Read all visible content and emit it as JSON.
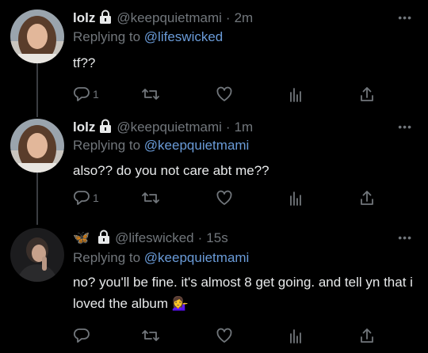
{
  "tweets": [
    {
      "name": "lolz",
      "handle": "@keepquietmami",
      "dot": "·",
      "time": "2m",
      "reply_prefix": "Replying to",
      "reply_to": "@lifeswicked",
      "text": "tf??",
      "reply_count": "1",
      "more": "•••"
    },
    {
      "name": "lolz",
      "handle": "@keepquietmami",
      "dot": "·",
      "time": "1m",
      "reply_prefix": "Replying to",
      "reply_to": "@keepquietmami",
      "text": "also?? do you not care abt me??",
      "reply_count": "1",
      "more": "•••"
    },
    {
      "name": "🦋",
      "handle": "@lifeswicked",
      "dot": "·",
      "time": "15s",
      "reply_prefix": "Replying to",
      "reply_to": "@keepquietmami",
      "text": "no? you'll be fine. it's almost 8 get going. and tell yn that i loved the album 💁‍♀️",
      "reply_count": "",
      "more": "•••"
    }
  ],
  "colors": {
    "background": "#000000",
    "text": "#e7e9ea",
    "muted": "#71767b",
    "mention": "#6a9bd8"
  },
  "icons": [
    "lock-icon",
    "reply-icon",
    "retweet-icon",
    "like-icon",
    "analytics-icon",
    "share-icon",
    "more-icon"
  ]
}
